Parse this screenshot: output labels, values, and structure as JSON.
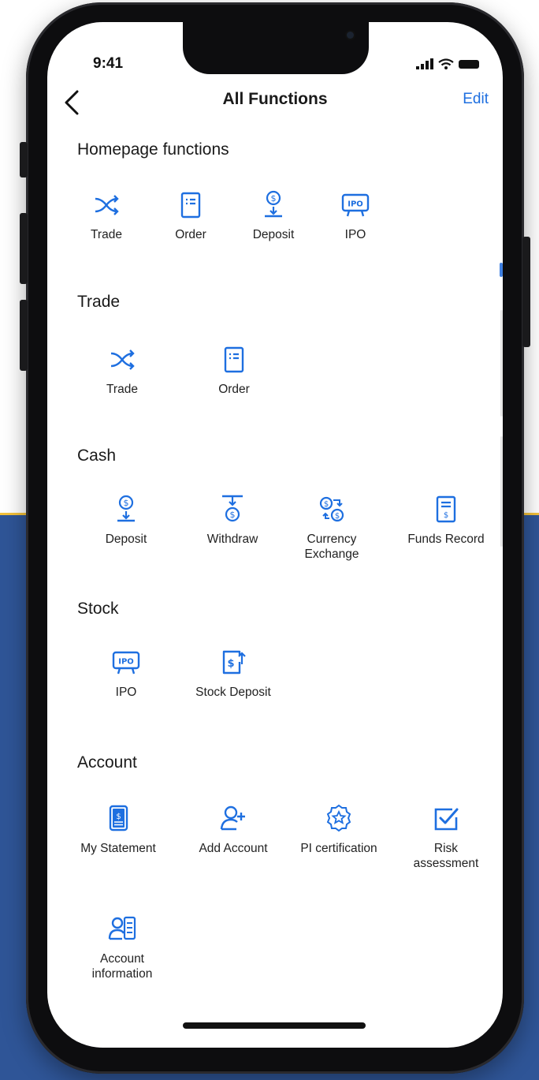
{
  "status_bar": {
    "time": "9:41"
  },
  "nav": {
    "title": "All Functions",
    "edit_label": "Edit"
  },
  "sections": {
    "homepage": {
      "title": "Homepage  functions",
      "items": [
        {
          "label": "Trade",
          "icon": "trade-shuffle-icon"
        },
        {
          "label": "Order",
          "icon": "order-list-icon"
        },
        {
          "label": "Deposit",
          "icon": "deposit-coin-icon"
        },
        {
          "label": "IPO",
          "icon": "ipo-board-icon"
        }
      ]
    },
    "trade": {
      "title": "Trade",
      "items": [
        {
          "label": "Trade",
          "icon": "trade-shuffle-icon"
        },
        {
          "label": "Order",
          "icon": "order-list-icon"
        }
      ]
    },
    "cash": {
      "title": "Cash",
      "items": [
        {
          "label": "Deposit",
          "icon": "deposit-coin-icon"
        },
        {
          "label": "Withdraw",
          "icon": "withdraw-coin-icon"
        },
        {
          "label": "Currency\nExchange",
          "icon": "currency-exchange-icon"
        },
        {
          "label": "Funds Record",
          "icon": "funds-record-icon"
        }
      ]
    },
    "stock": {
      "title": "Stock",
      "items": [
        {
          "label": "IPO",
          "icon": "ipo-board-icon"
        },
        {
          "label": "Stock Deposit",
          "icon": "stock-deposit-icon"
        }
      ]
    },
    "account": {
      "title": "Account",
      "items": [
        {
          "label": "My Statement",
          "icon": "statement-icon"
        },
        {
          "label": "Add Account",
          "icon": "add-user-icon"
        },
        {
          "label": "PI certification",
          "icon": "badge-star-icon"
        },
        {
          "label": "Risk\nassessment",
          "icon": "checkbox-icon"
        },
        {
          "label": "Account\ninformation",
          "icon": "account-info-icon"
        }
      ]
    }
  },
  "colors": {
    "accent": "#1e6fe0",
    "band": "#2f5597",
    "band_edge": "#f3c13a"
  }
}
